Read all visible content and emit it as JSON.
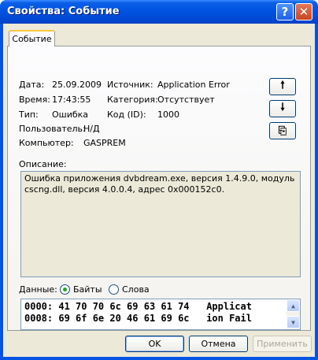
{
  "window": {
    "title": "Свойства: Событие",
    "help_glyph": "?",
    "close_glyph": "✕"
  },
  "tab": {
    "label": "Событие"
  },
  "fields": {
    "date_label": "Дата:",
    "date_value": "25.09.2009",
    "source_label": "Источник:",
    "source_value": "Application Error",
    "time_label": "Время:",
    "time_value": "17:43:55",
    "category_label": "Категория:",
    "category_value": "Отсутствует",
    "type_label": "Тип:",
    "type_value": "Ошибка",
    "code_label": "Код (ID):",
    "code_value": "1000",
    "user_label": "Пользователь:",
    "user_value": "Н/Д",
    "computer_label": "Компьютер:",
    "computer_value": "GASPREM"
  },
  "side_buttons": {
    "up_glyph": "🠕",
    "down_glyph": "🠗",
    "copy_glyph": "⎘"
  },
  "description": {
    "label": "Описание:",
    "text": "Ошибка приложения dvbdream.exe, версия 1.4.9.0, модуль cscng.dll, версия 4.0.0.4, адрес 0x000152c0."
  },
  "data_section": {
    "label": "Данные:",
    "option_bytes": "Байты",
    "option_words": "Слова",
    "selected": "Байты",
    "lines": [
      "0000: 41 70 70 6c 69 63 61 74   Applicat",
      "0008: 69 6f 6e 20 46 61 69 6c   ion Fail"
    ]
  },
  "buttons": {
    "ok": "OK",
    "cancel": "Отмена",
    "apply": "Применить"
  },
  "colors": {
    "titlebar": "#0054e3",
    "face": "#ece9d8",
    "close": "#c9451f",
    "radio_checked": "#21a121"
  }
}
